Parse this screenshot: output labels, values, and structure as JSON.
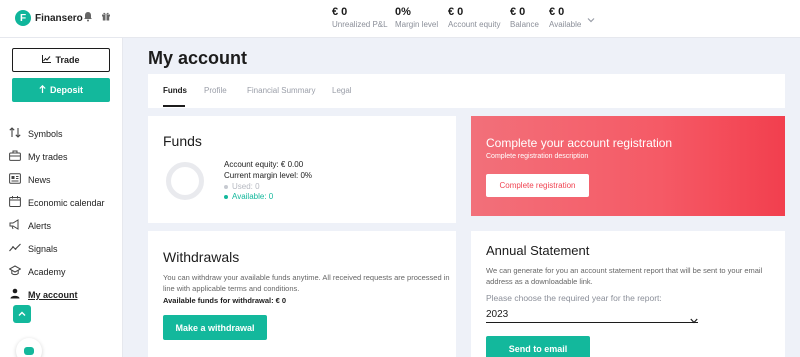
{
  "app": {
    "brand": "Finansero",
    "brand_initial": "F",
    "accent_color": "#13b89c",
    "danger_color": "#f23f4e"
  },
  "topbar": {
    "icons": [
      "bell-icon",
      "gift-icon",
      "chevron-down-icon"
    ],
    "metrics": [
      {
        "value": "€ 0",
        "label": "Unrealized P&L"
      },
      {
        "value": "0%",
        "label": "Margin level"
      },
      {
        "value": "€ 0",
        "label": "Account equity"
      },
      {
        "value": "€ 0",
        "label": "Balance"
      },
      {
        "value": "€ 0",
        "label": "Available"
      }
    ]
  },
  "sidebar": {
    "trade_label": "Trade",
    "deposit_label": "Deposit",
    "items": [
      {
        "label": "Symbols",
        "icon": "sort-arrows-icon"
      },
      {
        "label": "My trades",
        "icon": "briefcase-icon"
      },
      {
        "label": "News",
        "icon": "news-icon"
      },
      {
        "label": "Economic calendar",
        "icon": "calendar-icon"
      },
      {
        "label": "Alerts",
        "icon": "megaphone-icon"
      },
      {
        "label": "Signals",
        "icon": "signal-chart-icon"
      },
      {
        "label": "Academy",
        "icon": "graduation-cap-icon"
      },
      {
        "label": "My account",
        "icon": "user-icon",
        "active": true
      }
    ]
  },
  "main": {
    "title": "My account",
    "tabs": [
      {
        "label": "Funds",
        "active": true
      },
      {
        "label": "Profile"
      },
      {
        "label": "Financial Summary"
      },
      {
        "label": "Legal"
      }
    ],
    "funds": {
      "title": "Funds",
      "equity": "Account equity: € 0.00",
      "margin": "Current margin level: 0%",
      "used": "Used: 0",
      "available": "Available: 0"
    },
    "registration": {
      "title": "Complete your account registration",
      "description": "Complete registration description",
      "button": "Complete registration"
    },
    "withdrawals": {
      "title": "Withdrawals",
      "text": "You can withdraw your available funds anytime. All received requests are processed in line with applicable terms and conditions.",
      "available": "Available funds for withdrawal: € 0",
      "button": "Make a withdrawal"
    },
    "statement": {
      "title": "Annual Statement",
      "text": "We can generate for you an account statement report that will be sent to your email address as a downloadable link.",
      "choose_label": "Please choose the required year for the report:",
      "year": "2023",
      "button": "Send to email"
    }
  }
}
